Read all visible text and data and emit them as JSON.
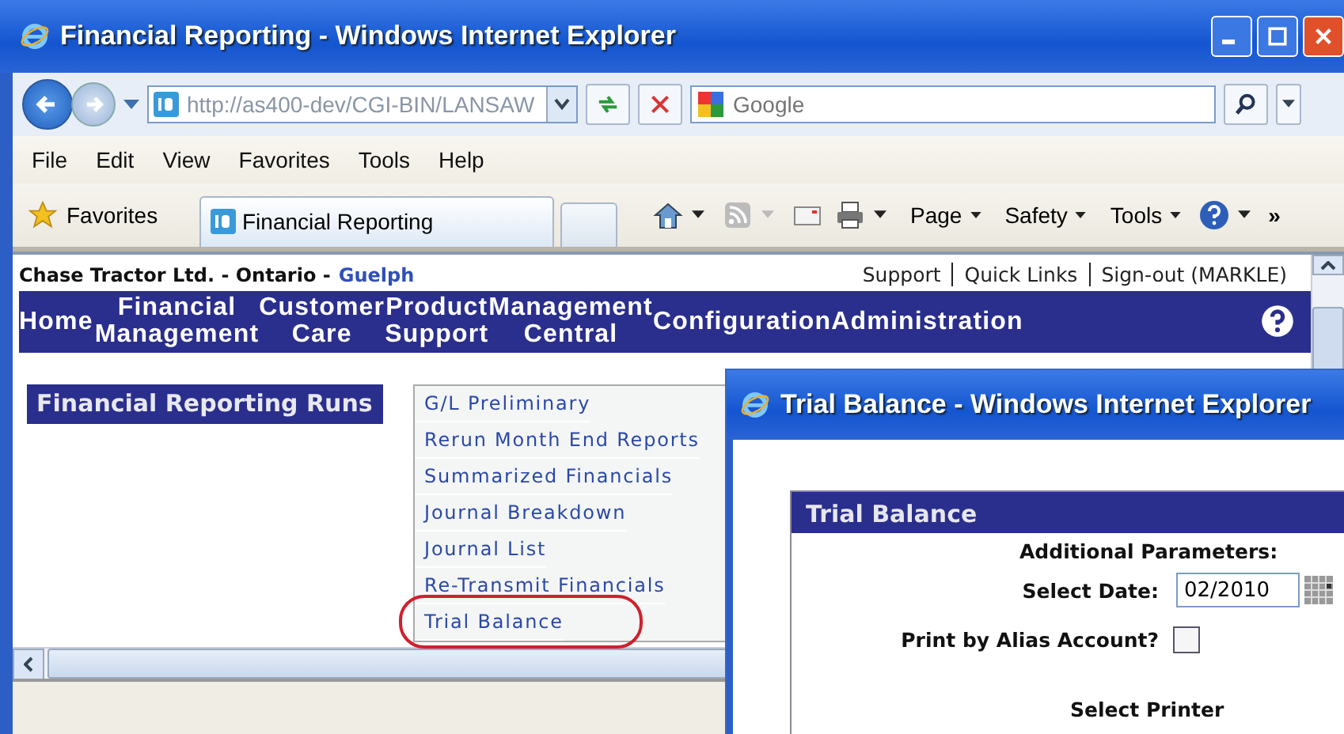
{
  "window": {
    "title": "Financial Reporting - Windows Internet Explorer"
  },
  "address_bar": {
    "url": "http://as400-dev/CGI-BIN/LANSAW"
  },
  "search": {
    "placeholder": "Google"
  },
  "menu_bar": [
    "File",
    "Edit",
    "View",
    "Favorites",
    "Tools",
    "Help"
  ],
  "favorites_bar": {
    "favorites": "Favorites",
    "tab": "Financial Reporting",
    "commands": [
      "Page",
      "Safety",
      "Tools"
    ],
    "overflow": "»"
  },
  "page": {
    "company": "Chase Tractor Ltd. - Ontario -",
    "location": "Guelph",
    "links": [
      "Support",
      "Quick Links",
      "Sign-out (MARKLE)"
    ],
    "nav": [
      {
        "lines": [
          "Home"
        ]
      },
      {
        "lines": [
          "Financial",
          "Management"
        ]
      },
      {
        "lines": [
          "Customer",
          "Care"
        ]
      },
      {
        "lines": [
          "Product",
          "Support"
        ]
      },
      {
        "lines": [
          "Management",
          "Central"
        ]
      },
      {
        "lines": [
          "Configuration"
        ]
      },
      {
        "lines": [
          "Administration"
        ]
      }
    ],
    "section_title": "Financial Reporting Runs",
    "menu_items": [
      {
        "label": "G/L Preliminary",
        "highlighted": false
      },
      {
        "label": "Rerun Month End Reports",
        "highlighted": false
      },
      {
        "label": "Summarized Financials",
        "highlighted": false
      },
      {
        "label": "Journal Breakdown",
        "highlighted": false
      },
      {
        "label": "Journal List",
        "highlighted": false
      },
      {
        "label": "Re-Transmit Financials",
        "highlighted": false
      },
      {
        "label": "Trial Balance",
        "highlighted": true
      }
    ]
  },
  "dialog": {
    "title": "Trial Balance - Windows Internet Explorer",
    "panel_title": "Trial Balance",
    "heading": "Additional Parameters:",
    "date_label": "Select Date:",
    "date_value": "02/2010",
    "alias_label": "Print by Alias Account?",
    "alias_checked": false,
    "printer_label": "Select Printer"
  }
}
